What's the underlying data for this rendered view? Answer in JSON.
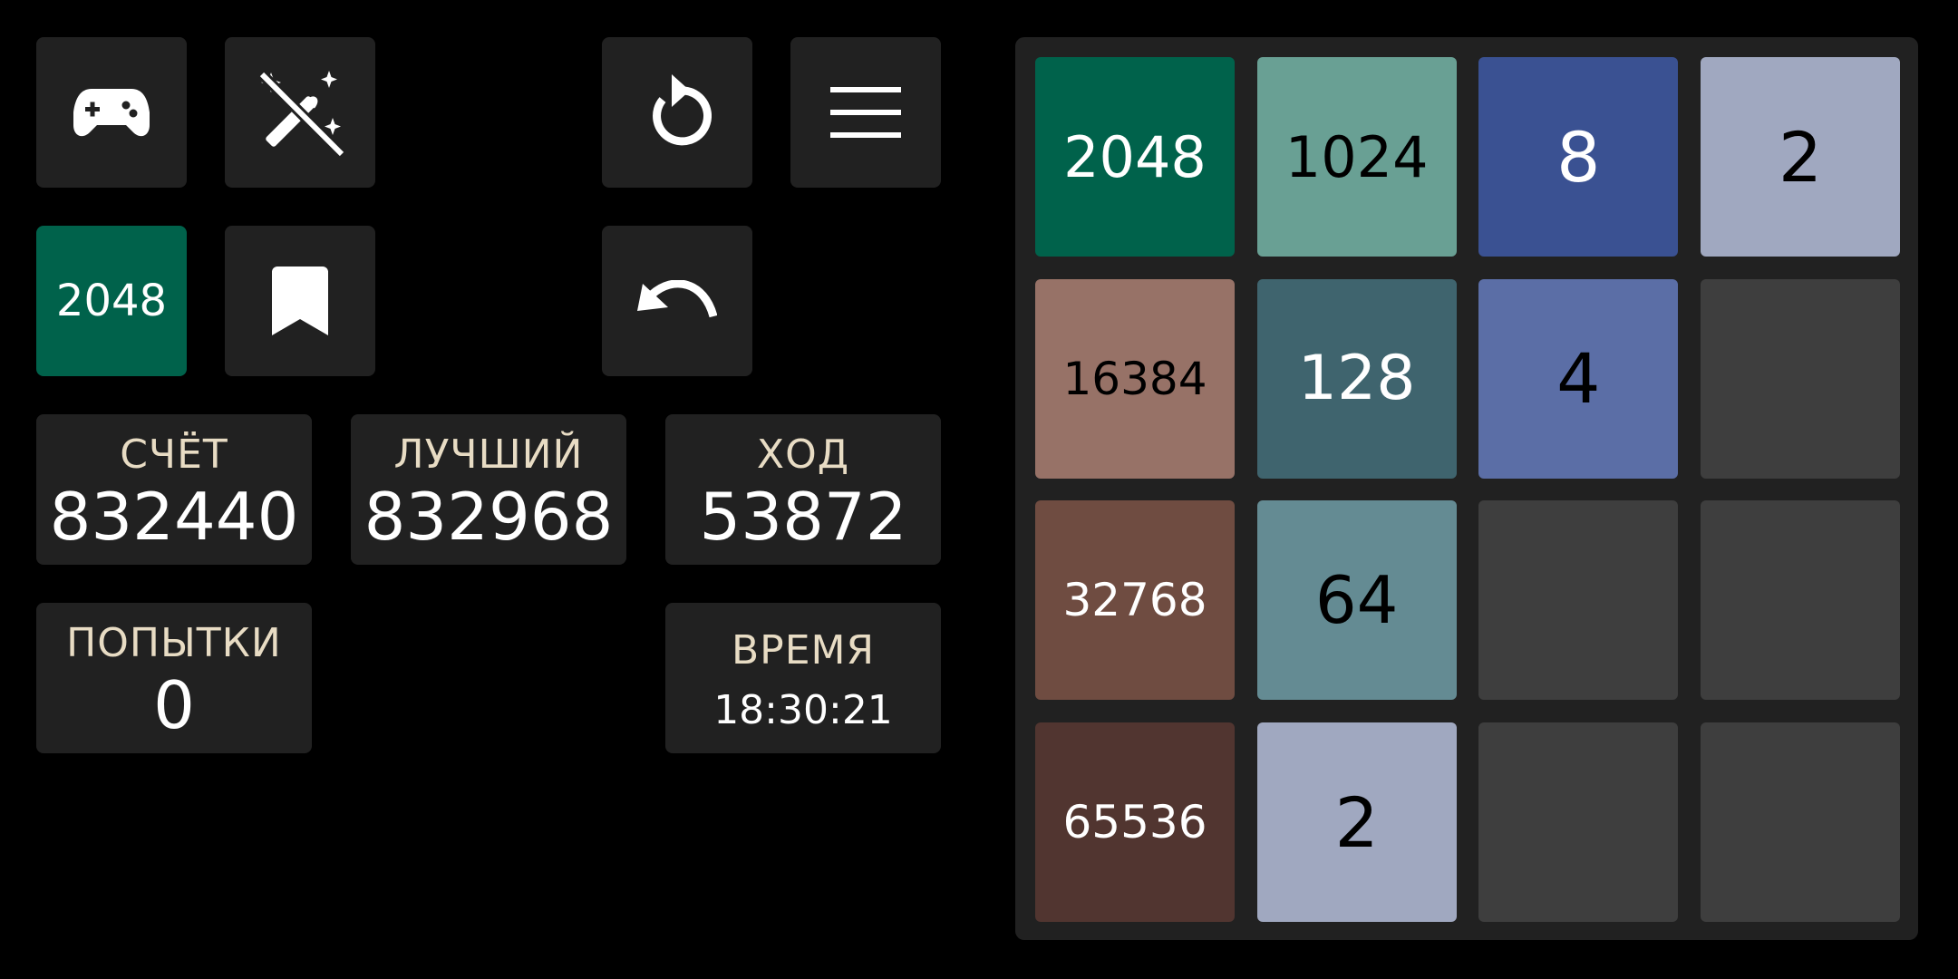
{
  "toolbar": {
    "mode_label": "2048"
  },
  "stats": {
    "score_label": "СЧЁТ",
    "score_value": "832440",
    "best_label": "ЛУЧШИЙ",
    "best_value": "832968",
    "moves_label": "ХОД",
    "moves_value": "53872",
    "attempts_label": "ПОПЫТКИ",
    "attempts_value": "0",
    "time_label": "ВРЕМЯ",
    "time_value": "18:30:21"
  },
  "board": {
    "size": 4,
    "tiles": [
      [
        "2048",
        "1024",
        "8",
        "2"
      ],
      [
        "16384",
        "128",
        "4",
        ""
      ],
      [
        "32768",
        "64",
        "",
        ""
      ],
      [
        "65536",
        "2",
        "",
        ""
      ]
    ]
  },
  "colors": {
    "background": "#000000",
    "panel": "#212121",
    "empty_cell": "#3e3e3e",
    "label_text": "#e8dcc4",
    "tile_2": "#a0a8c0",
    "tile_4": "#5b6ea6",
    "tile_8": "#3a5192",
    "tile_64": "#648b93",
    "tile_128": "#3f646e",
    "tile_1024": "#69a094",
    "tile_2048": "#00624b",
    "tile_16384": "#977267",
    "tile_32768": "#6f4c41",
    "tile_65536": "#513530"
  },
  "icons": {
    "game": "gamepad-icon",
    "magic_off": "magic-wand-off-icon",
    "restart": "restart-icon",
    "menu": "hamburger-menu-icon",
    "bookmark": "bookmark-icon",
    "undo": "undo-icon"
  }
}
